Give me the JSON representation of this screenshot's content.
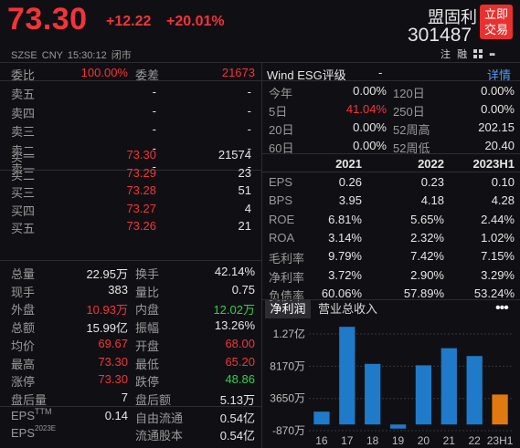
{
  "header": {
    "price": "73.30",
    "change": "+12.22",
    "change_pct": "+20.01%",
    "meta": "SZSE  CNY  15:30:12  闭市",
    "stock_name": "盟固利",
    "stock_code": "301487",
    "trade_btn_line1": "立即",
    "trade_btn_line2": "交易",
    "icon_note": "注",
    "icon_margin": "融",
    "icon_grid": "grid-icon",
    "icon_overflow": "more-icon"
  },
  "order_ratio": {
    "label1": "委比",
    "value1": "100.00%",
    "label2": "委差",
    "value2": "21673"
  },
  "asks": [
    {
      "label": "卖五",
      "price": "-",
      "volume": "-"
    },
    {
      "label": "卖四",
      "price": "-",
      "volume": "-"
    },
    {
      "label": "卖三",
      "price": "-",
      "volume": "-"
    },
    {
      "label": "卖二",
      "price": "-",
      "volume": "-"
    },
    {
      "label": "卖一",
      "price": "-",
      "volume": "-"
    }
  ],
  "bids": [
    {
      "label": "买一",
      "price": "73.30",
      "volume": "21574"
    },
    {
      "label": "买二",
      "price": "73.29",
      "volume": "23"
    },
    {
      "label": "买三",
      "price": "73.28",
      "volume": "51"
    },
    {
      "label": "买四",
      "price": "73.27",
      "volume": "4"
    },
    {
      "label": "买五",
      "price": "73.26",
      "volume": "21"
    }
  ],
  "stats": [
    {
      "l1": "总量",
      "v1": "22.95万",
      "c1": "white",
      "l2": "换手",
      "v2": "42.14%",
      "c2": "white"
    },
    {
      "l1": "现手",
      "v1": "383",
      "c1": "white",
      "l2": "量比",
      "v2": "0.75",
      "c2": "white"
    },
    {
      "l1": "外盘",
      "v1": "10.93万",
      "c1": "red",
      "l2": "内盘",
      "v2": "12.02万",
      "c2": "green"
    },
    {
      "l1": "总额",
      "v1": "15.99亿",
      "c1": "white",
      "l2": "振幅",
      "v2": "13.26%",
      "c2": "white"
    },
    {
      "l1": "均价",
      "v1": "69.67",
      "c1": "red",
      "l2": "开盘",
      "v2": "68.00",
      "c2": "red"
    },
    {
      "l1": "最高",
      "v1": "73.30",
      "c1": "red",
      "l2": "最低",
      "v2": "65.20",
      "c2": "red"
    },
    {
      "l1": "涨停",
      "v1": "73.30",
      "c1": "red",
      "l2": "跌停",
      "v2": "48.86",
      "c2": "green"
    },
    {
      "l1": "盘后量",
      "v1": "7",
      "c1": "white",
      "l2": "盘后额",
      "v2": "5.13万",
      "c2": "white"
    },
    {
      "l1": "EPS",
      "l1sup": "TTM",
      "v1": "0.14",
      "c1": "white",
      "l2": "自由流通",
      "v2": "0.54亿",
      "c2": "white"
    },
    {
      "l1": "EPS",
      "l1sup": "2023E",
      "v1": "",
      "c1": "white",
      "l2": "流通股本",
      "v2": "0.54亿",
      "c2": "white"
    }
  ],
  "esg": {
    "label": "Wind  ESG评级",
    "value": "-",
    "detail": "详情"
  },
  "perf": [
    {
      "l1": "今年",
      "v1": "0.00%",
      "c1": "white",
      "l2": "120日",
      "v2": "0.00%"
    },
    {
      "l1": "5日",
      "v1": "41.04%",
      "c1": "red",
      "l2": "250日",
      "v2": "0.00%"
    },
    {
      "l1": "20日",
      "v1": "0.00%",
      "c1": "white",
      "l2": "52周高",
      "v2": "202.15"
    },
    {
      "l1": "60日",
      "v1": "0.00%",
      "c1": "white",
      "l2": "52周低",
      "v2": "20.40"
    }
  ],
  "fin_years": [
    "2021",
    "2022",
    "2023H1"
  ],
  "fin_rows": [
    {
      "label": "EPS",
      "values": [
        "0.26",
        "0.23",
        "0.10"
      ]
    },
    {
      "label": "BPS",
      "values": [
        "3.95",
        "4.18",
        "4.28"
      ]
    },
    {
      "label": "ROE",
      "values": [
        "6.81%",
        "5.65%",
        "2.44%"
      ]
    },
    {
      "label": "ROA",
      "values": [
        "3.14%",
        "2.32%",
        "1.02%"
      ]
    },
    {
      "label": "毛利率",
      "values": [
        "9.79%",
        "7.42%",
        "7.15%"
      ]
    },
    {
      "label": "净利率",
      "values": [
        "3.72%",
        "2.90%",
        "3.29%"
      ]
    },
    {
      "label": "负债率",
      "values": [
        "60.06%",
        "57.89%",
        "53.24%"
      ]
    }
  ],
  "tabs": {
    "net_profit": "净利润",
    "revenue": "营业总收入"
  },
  "chart_data": {
    "type": "bar",
    "categories": [
      "16",
      "17",
      "18",
      "19",
      "20",
      "21",
      "22",
      "23H1"
    ],
    "values": [
      1800,
      13700,
      8500,
      -580,
      8300,
      10700,
      9600,
      4200
    ],
    "ylim": [
      -870,
      12700
    ],
    "yticks": [
      "1.27亿",
      "8170万",
      "3650万",
      "-870万"
    ],
    "ytick_values": [
      12700,
      8170,
      3650,
      -870
    ],
    "colors": [
      "#1f7ac9",
      "#1f7ac9",
      "#1f7ac9",
      "#1f7ac9",
      "#1f7ac9",
      "#1f7ac9",
      "#1f7ac9",
      "#e07a10"
    ]
  }
}
